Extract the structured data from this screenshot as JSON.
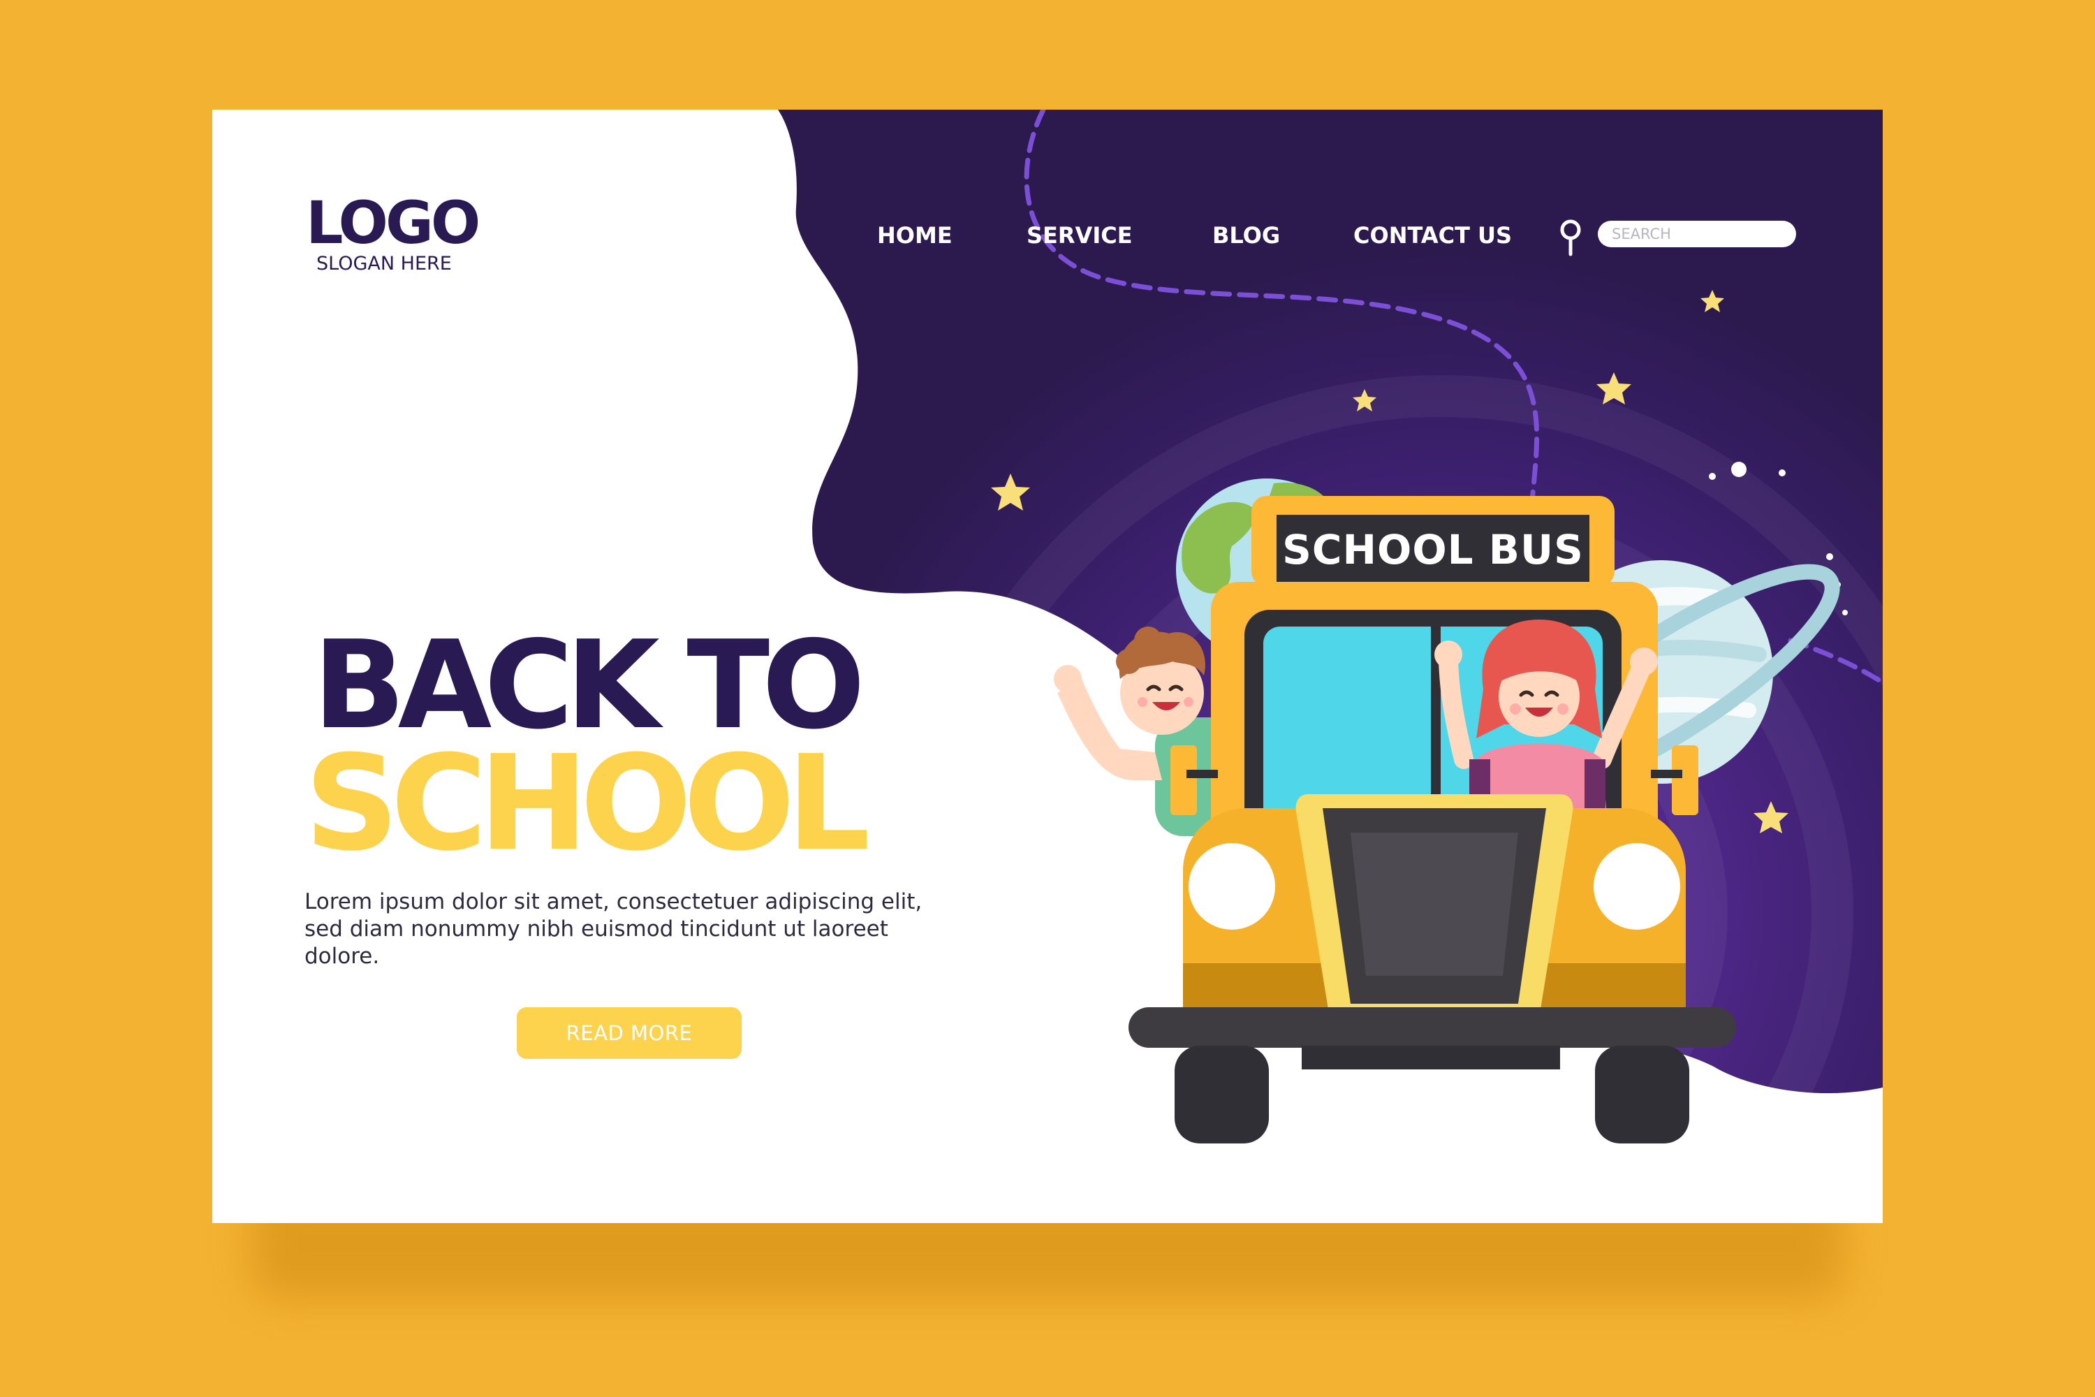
{
  "brand": {
    "logo_text": "LOGO",
    "slogan": "SLOGAN HERE"
  },
  "nav": {
    "items": [
      {
        "label": "HOME"
      },
      {
        "label": "SERVICE"
      },
      {
        "label": "BLOG"
      },
      {
        "label": "CONTACT US"
      }
    ],
    "search_placeholder": "SEARCH",
    "search_icon": "magnifier-pin-icon"
  },
  "hero": {
    "title_line1": "BACK TO",
    "title_line2": "SCHOOL",
    "body": "Lorem ipsum dolor sit amet, consectetuer adipiscing elit, sed diam nonummy nibh euismod tincidunt ut laoreet dolore.",
    "cta_label": "READ MORE"
  },
  "illustration": {
    "bus_sign": "SCHOOL BUS",
    "elements": [
      "school-bus",
      "boy-waving",
      "girl-waving",
      "earth-planet",
      "ringed-planet",
      "stars",
      "dashed-orbit-path"
    ]
  },
  "colors": {
    "background": "#f3b232",
    "card": "#ffffff",
    "space_dark": "#2c1a4e",
    "space_glow": "#5a2c95",
    "primary_text": "#2a1a54",
    "accent_yellow": "#fdd24c",
    "bus_yellow": "#f5b12a",
    "bus_window": "#4fd6e8"
  }
}
